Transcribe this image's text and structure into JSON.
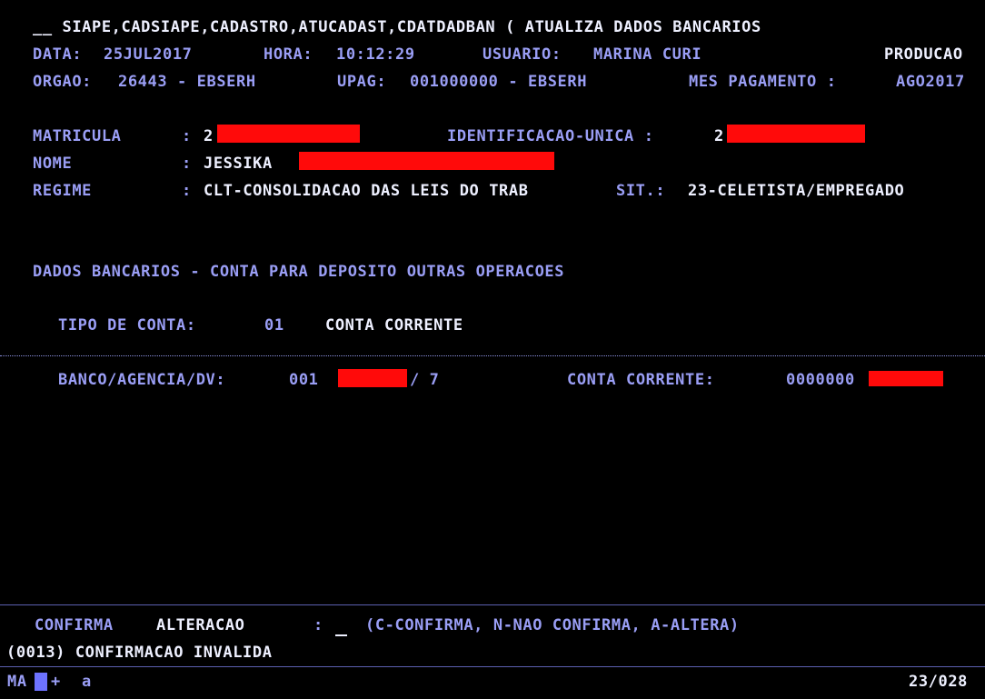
{
  "header": {
    "line1": "__ SIAPE,CADSIAPE,CADASTRO,ATUCADAST,CDATDADBAN ( ATUALIZA DADOS BANCARIOS",
    "data_label": "DATA:",
    "data_value": "25JUL2017",
    "hora_label": "HORA:",
    "hora_value": "10:12:29",
    "usuario_label": "USUARIO:",
    "usuario_value": "MARINA CURI",
    "environment": "PRODUCAO",
    "orgao_label": "ORGAO:",
    "orgao_value": "26443 - EBSERH",
    "upag_label": "UPAG:",
    "upag_value": "001000000 - EBSERH",
    "mes_label": "MES PAGAMENTO :",
    "mes_value": "AGO2017"
  },
  "person": {
    "matricula_label": "MATRICULA",
    "matricula_sep": ":",
    "matricula_value": "2",
    "identificacao_label": "IDENTIFICACAO-UNICA :",
    "identificacao_value": "2",
    "nome_label": "NOME",
    "nome_sep": ":",
    "nome_value": "JESSIKA",
    "regime_label": "REGIME",
    "regime_sep": ":",
    "regime_value": "CLT-CONSOLIDACAO DAS LEIS DO TRAB",
    "sit_label": "SIT.:",
    "sit_value": "23-CELETISTA/EMPREGADO"
  },
  "bank": {
    "section_title": "DADOS BANCARIOS - CONTA PARA DEPOSITO OUTRAS OPERACOES",
    "tipo_label": "TIPO DE CONTA:",
    "tipo_code": "01",
    "tipo_desc": "CONTA CORRENTE",
    "banco_label": "BANCO/AGENCIA/DV:",
    "banco_code": "001",
    "dv_value": "/ 7",
    "conta_label": "CONTA CORRENTE:",
    "conta_value": "0000000"
  },
  "footer": {
    "confirma_label": "CONFIRMA",
    "alteracao_label": "ALTERACAO",
    "confirma_sep": ":",
    "confirma_input_value": "",
    "options_hint": "(C-CONFIRMA, N-NAO CONFIRMA, A-ALTERA)",
    "message": "(0013) CONFIRMACAO INVALIDA"
  },
  "statusbar": {
    "mode": "MA",
    "indicator": "+",
    "session": "a",
    "cursor_position": "23/028"
  },
  "colors": {
    "background": "#000000",
    "field_label": "#9a9ef5",
    "field_value": "#eef0ff",
    "redaction": "#ff0a0a",
    "cursor_block": "#6d72ff"
  }
}
